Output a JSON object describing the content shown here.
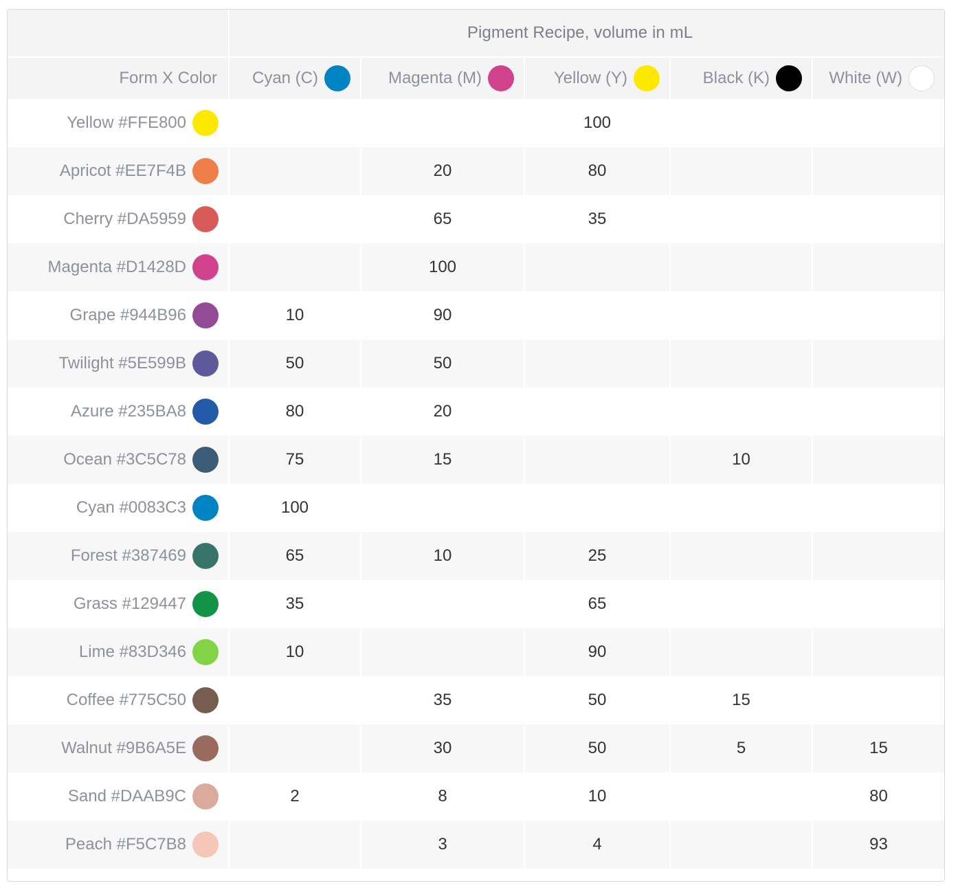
{
  "table": {
    "banner_title": "Pigment Recipe, volume in mL",
    "row_header_label": "Form X Color",
    "columns": [
      {
        "label": "Cyan (C)",
        "swatch": "#0083C3",
        "icon": "cyan-swatch-icon"
      },
      {
        "label": "Magenta (M)",
        "swatch": "#D1428D",
        "icon": "magenta-swatch-icon"
      },
      {
        "label": "Yellow (Y)",
        "swatch": "#FFE800",
        "icon": "yellow-swatch-icon"
      },
      {
        "label": "Black (K)",
        "swatch": "#000000",
        "icon": "black-swatch-icon"
      },
      {
        "label": "White (W)",
        "swatch": "#FFFFFF",
        "icon": "white-swatch-icon"
      }
    ],
    "rows": [
      {
        "name": "Yellow #FFE800",
        "swatch": "#FFE800",
        "c": "",
        "m": "",
        "y": "100",
        "k": "",
        "w": ""
      },
      {
        "name": "Apricot #EE7F4B",
        "swatch": "#EE7F4B",
        "c": "",
        "m": "20",
        "y": "80",
        "k": "",
        "w": ""
      },
      {
        "name": "Cherry #DA5959",
        "swatch": "#DA5959",
        "c": "",
        "m": "65",
        "y": "35",
        "k": "",
        "w": ""
      },
      {
        "name": "Magenta #D1428D",
        "swatch": "#D1428D",
        "c": "",
        "m": "100",
        "y": "",
        "k": "",
        "w": ""
      },
      {
        "name": "Grape #944B96",
        "swatch": "#944B96",
        "c": "10",
        "m": "90",
        "y": "",
        "k": "",
        "w": ""
      },
      {
        "name": "Twilight #5E599B",
        "swatch": "#5E599B",
        "c": "50",
        "m": "50",
        "y": "",
        "k": "",
        "w": ""
      },
      {
        "name": "Azure #235BA8",
        "swatch": "#235BA8",
        "c": "80",
        "m": "20",
        "y": "",
        "k": "",
        "w": ""
      },
      {
        "name": "Ocean #3C5C78",
        "swatch": "#3C5C78",
        "c": "75",
        "m": "15",
        "y": "",
        "k": "10",
        "w": ""
      },
      {
        "name": "Cyan #0083C3",
        "swatch": "#0083C3",
        "c": "100",
        "m": "",
        "y": "",
        "k": "",
        "w": ""
      },
      {
        "name": "Forest #387469",
        "swatch": "#387469",
        "c": "65",
        "m": "10",
        "y": "25",
        "k": "",
        "w": ""
      },
      {
        "name": "Grass #129447",
        "swatch": "#129447",
        "c": "35",
        "m": "",
        "y": "65",
        "k": "",
        "w": ""
      },
      {
        "name": "Lime #83D346",
        "swatch": "#83D346",
        "c": "10",
        "m": "",
        "y": "90",
        "k": "",
        "w": ""
      },
      {
        "name": "Coffee #775C50",
        "swatch": "#775C50",
        "c": "",
        "m": "35",
        "y": "50",
        "k": "15",
        "w": ""
      },
      {
        "name": "Walnut #9B6A5E",
        "swatch": "#9B6A5E",
        "c": "",
        "m": "30",
        "y": "50",
        "k": "5",
        "w": "15"
      },
      {
        "name": "Sand #DAAB9C",
        "swatch": "#DAAB9C",
        "c": "2",
        "m": "8",
        "y": "10",
        "k": "",
        "w": "80"
      },
      {
        "name": "Peach #F5C7B8",
        "swatch": "#F5C7B8",
        "c": "",
        "m": "3",
        "y": "4",
        "k": "",
        "w": "93"
      }
    ]
  }
}
